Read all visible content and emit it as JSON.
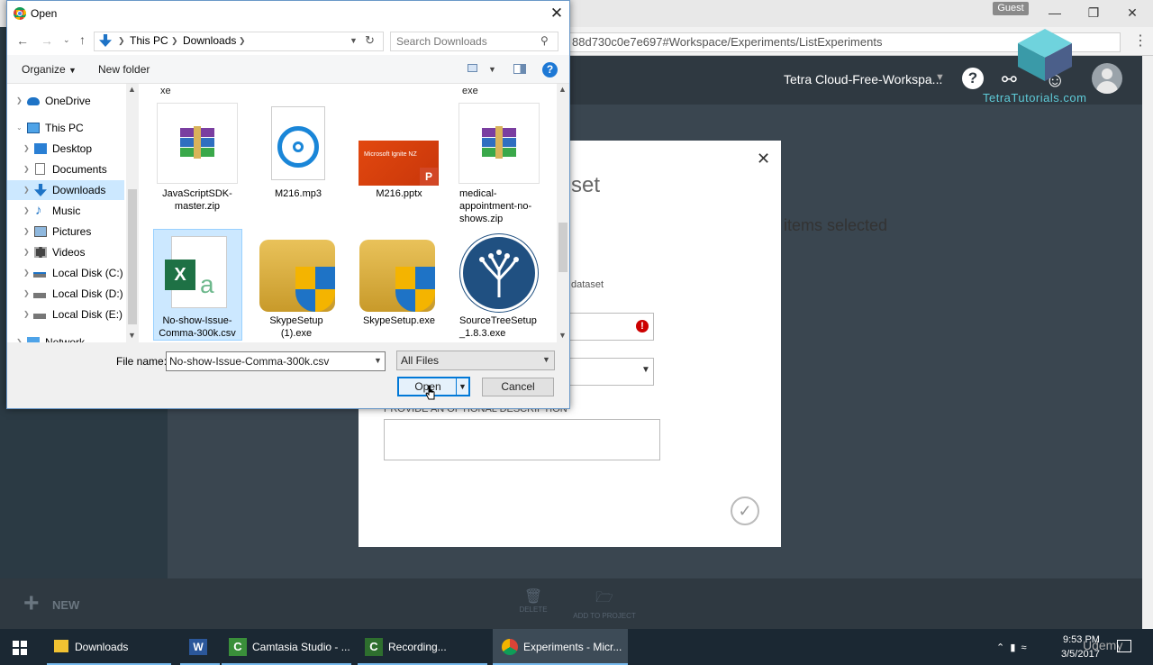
{
  "browser": {
    "guest_label": "Guest",
    "url": "88d730c0e7e697#Workspace/Experiments/ListExperiments"
  },
  "app": {
    "workspace_name": "Tetra Cloud-Free-Workspa...",
    "brand": "TetraTutorials.com",
    "new_label": "NEW",
    "delete_label": "DELETE",
    "add_to_project_label": "ADD TO PROJECT"
  },
  "modal": {
    "title_fragment": "set",
    "items_selected": "items selected",
    "dataset_label": "dataset",
    "description_label": "PROVIDE AN OPTIONAL DESCRIPTION"
  },
  "dialog": {
    "title": "Open",
    "breadcrumb": [
      "This PC",
      "Downloads"
    ],
    "search_placeholder": "Search Downloads",
    "organize_label": "Organize",
    "new_folder_label": "New folder",
    "nav_items": [
      {
        "label": "OneDrive",
        "icon": "cloud-icon"
      },
      {
        "label": "This PC",
        "icon": "pc-icon"
      },
      {
        "label": "Desktop",
        "icon": "desktop-icon"
      },
      {
        "label": "Documents",
        "icon": "documents-icon"
      },
      {
        "label": "Downloads",
        "icon": "download-icon"
      },
      {
        "label": "Music",
        "icon": "music-icon"
      },
      {
        "label": "Pictures",
        "icon": "pictures-icon"
      },
      {
        "label": "Videos",
        "icon": "videos-icon"
      },
      {
        "label": "Local Disk (C:)",
        "icon": "disk-icon"
      },
      {
        "label": "Local Disk (D:)",
        "icon": "disk-icon"
      },
      {
        "label": "Local Disk (E:)",
        "icon": "disk-icon"
      },
      {
        "label": "Network",
        "icon": "network-icon"
      }
    ],
    "top_fragments": [
      "xe",
      "exe"
    ],
    "files": [
      {
        "name": "JavaScriptSDK-master.zip",
        "icon": "winrar-archive-icon"
      },
      {
        "name": "M216.mp3",
        "icon": "music-file-icon"
      },
      {
        "name": "M216.pptx",
        "icon": "pptx-thumbnail",
        "thumb_text": "Microsoft Ignite NZ"
      },
      {
        "name": "medical-appointment-no-shows.zip",
        "icon": "winrar-archive-icon"
      },
      {
        "name": "No-show-Issue-Comma-300k.csv",
        "icon": "excel-csv-icon"
      },
      {
        "name": "SkypeSetup (1).exe",
        "icon": "installer-shield-icon"
      },
      {
        "name": "SkypeSetup.exe",
        "icon": "installer-shield-icon"
      },
      {
        "name": "SourceTreeSetup_1.8.3.exe",
        "icon": "sourcetree-icon"
      }
    ],
    "file_name_label": "File name:",
    "file_name_value": "No-show-Issue-Comma-300k.csv",
    "file_type_value": "All Files",
    "open_label": "Open",
    "cancel_label": "Cancel"
  },
  "taskbar": {
    "items": [
      "Downloads",
      "",
      "Camtasia Studio - ...",
      "Recording...",
      "Experiments - Micr..."
    ],
    "time": "9:53 PM",
    "date": "3/5/2017",
    "watermark": "Udemy"
  }
}
